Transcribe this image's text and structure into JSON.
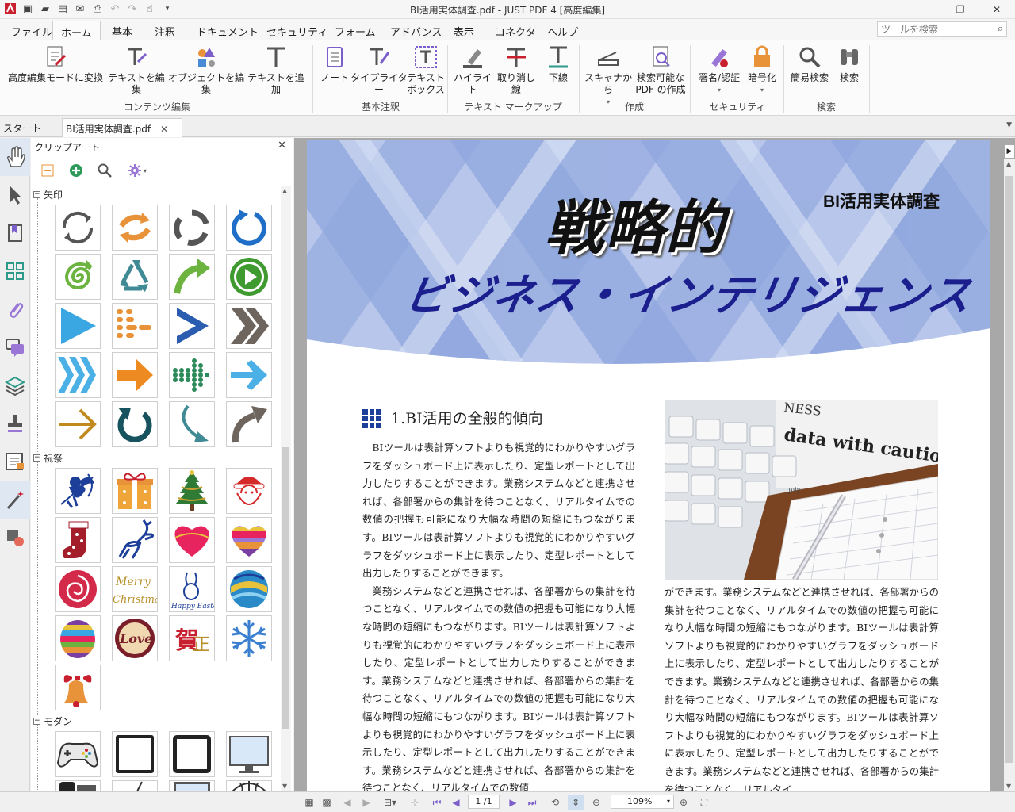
{
  "window": {
    "title": "BI活用実体調査.pdf - JUST PDF 4 [高度編集]",
    "controls": [
      "minimize-icon",
      "restore-icon",
      "close-icon"
    ]
  },
  "menu": {
    "tabs": [
      {
        "label": "ファイル"
      },
      {
        "label": "ホーム"
      },
      {
        "label": "基本"
      },
      {
        "label": "注釈"
      },
      {
        "label": "ドキュメント"
      },
      {
        "label": "セキュリティ"
      },
      {
        "label": "フォーム"
      },
      {
        "label": "アドバンス"
      },
      {
        "label": "表示"
      },
      {
        "label": "コネクタ"
      },
      {
        "label": "ヘルプ"
      }
    ],
    "active": "ホーム",
    "search_placeholder": "ツールを検索"
  },
  "ribbon": {
    "buttons": [
      {
        "label": "高度編集モードに変換",
        "icon": "advanced-edit-icon"
      },
      {
        "label": "テキストを編集",
        "icon": "edit-text-icon"
      },
      {
        "label": "オブジェクトを編集",
        "icon": "edit-object-icon"
      },
      {
        "label": "テキストを追加",
        "icon": "add-text-icon"
      },
      {
        "label": "ノート",
        "icon": "note-icon"
      },
      {
        "label": "タイプライター",
        "icon": "typewriter-icon"
      },
      {
        "label": "テキスト",
        "label2": "ボックス",
        "icon": "textbox-icon"
      },
      {
        "label": "ハイライト",
        "icon": "highlight-icon"
      },
      {
        "label": "取り消し線",
        "icon": "strikethrough-icon"
      },
      {
        "label": "下線",
        "icon": "underline-icon"
      },
      {
        "label": "スキャナから",
        "icon": "scanner-icon"
      },
      {
        "label": "検索可能な",
        "label2": "PDF の作成",
        "icon": "searchable-pdf-icon"
      },
      {
        "label": "署名/認証",
        "icon": "sign-icon"
      },
      {
        "label": "暗号化",
        "icon": "encrypt-icon"
      },
      {
        "label": "簡易検索",
        "icon": "quick-search-icon"
      },
      {
        "label": "検索",
        "icon": "binoculars-icon"
      }
    ],
    "groups": [
      {
        "label": "コンテンツ編集"
      },
      {
        "label": "基本注釈"
      },
      {
        "label": "テキスト マークアップ"
      },
      {
        "label": "作成"
      },
      {
        "label": "セキュリティ"
      },
      {
        "label": "検索"
      }
    ]
  },
  "doc_tabs": {
    "start": "スタート",
    "file": "BI活用実体調査.pdf"
  },
  "clipart": {
    "title": "クリップアート",
    "categories": [
      {
        "label": "矢印",
        "items": [
          "arrows-circle-gray",
          "arrows-circle-orange",
          "arrows-circle-dark",
          "refresh-blue",
          "spiral-green",
          "triangle-arrows-teal",
          "curved-arrow-green",
          "play-green",
          "play-blue",
          "dots-arrow-orange",
          "chevron-blue",
          "double-chevron-gray",
          "triple-chevron-blue",
          "arrow-right-orange",
          "dots-arrow-green",
          "arrow-right-blue",
          "arrow-thin-gold",
          "u-turn-teal",
          "curve-arrow-teal",
          "curve-arrow-gray"
        ]
      },
      {
        "label": "祝祭",
        "items": [
          "cupid-blue",
          "gift-orange",
          "christmas-tree",
          "santa-red",
          "stocking-red",
          "reindeer-blue",
          "heart-pink",
          "heart-striped",
          "rose-red",
          "merry-christmas-text",
          "happy-easter-bunny",
          "easter-egg-blue",
          "easter-egg-striped",
          "love-badge",
          "kanji-gold",
          "snowflake-blue",
          "bell-red"
        ]
      },
      {
        "label": "モダン",
        "items": [
          "gamepad",
          "tablet-frame",
          "tablet-frame-2",
          "monitor",
          "phone",
          "pen",
          "laptop",
          "globe"
        ]
      }
    ]
  },
  "document": {
    "hero_label": "BI活用実体調査",
    "hero_title": "戦略的",
    "hero_subtitle": "ビジネス・インテリジェンス",
    "section_title": "1.BI活用の全般的傾向",
    "col1_p1": "BIツールは表計算ソフトよりも視覚的にわかりやすいグラフをダッシュボード上に表示したり、定型レポートとして出力したりすることができます。業務システムなどと連携させれば、各部署からの集計を待つことなく、リアルタイムでの数値の把握も可能になり大幅な時間の短縮にもつながります。BIツールは表計算ソフトよりも視覚的にわかりやすいグラフをダッシュボード上に表示したり、定型レポートとして出力したりすることができます。",
    "col1_p2": "業務システムなどと連携させれば、各部署からの集計を待つことなく、リアルタイムでの数値の把握も可能になり大幅な時間の短縮にもつながります。BIツールは表計算ソフトよりも視覚的にわかりやすいグラフをダッシュボード上に表示したり、定型レポートとして出力したりすることができます。業務システムなどと連携させれば、各部署からの集計を待つことなく、リアルタイムでの数値の把握も可能になり大幅な時間の短縮にもつながります。BIツールは表計算ソフトよりも視覚的にわかりやすいグラフをダッシュボード上に表示したり、定型レポートとして出力したりすることができます。業務システムなどと連携させれば、各部署からの集計を待つことなく、リアルタイムでの数値",
    "col2_p1": "ができます。業務システムなどと連携させれば、各部署からの集計を待つことなく、リアルタイムでの数値の把握も可能になり大幅な時間の短縮にもつながります。BIツールは表計算ソフトよりも視覚的にわかりやすいグラフをダッシュボード上に表示したり、定型レポートとして出力したりすることができます。業務システムなどと連携させれば、各部署からの集計を待つことなく、リアルタイムでの数値の把握も可能になり大幅な時間の短縮にもつながります。BIツールは表計算ソフトよりも視覚的にわかりやすいグラフをダッシュボード上に表示したり、定型レポートとして出力したりすることができます。業務システムなどと連携させれば、各部署からの集計を待つことなく、リアルタイ",
    "photo_caption_text": "NESS data with caution",
    "photo_day": "July"
  },
  "status": {
    "page": "1 /1",
    "zoom": "109%"
  }
}
